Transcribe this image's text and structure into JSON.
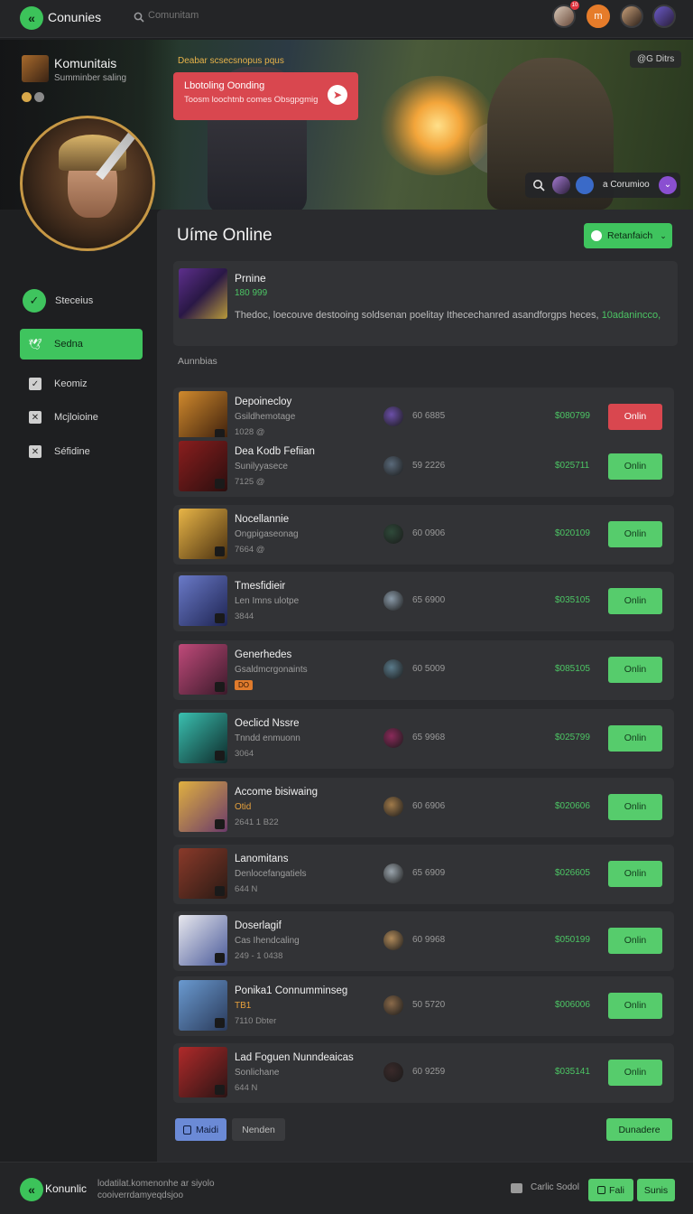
{
  "topbar": {
    "brand": "Conunies",
    "search_placeholder": "Comunitam",
    "notif_count": "10"
  },
  "profile": {
    "name": "Komunitais",
    "status": "Summinber saling"
  },
  "hero": {
    "caption": "Deabar scsecsnopus pqus",
    "tag": "@G Ditrs",
    "promo": {
      "title": "Lbotoling Oonding",
      "subtitle": "Toosm loochtnb comes Obsgpgmig"
    },
    "pill_label": "a Corumioo"
  },
  "nav": [
    {
      "label": "Steceius",
      "icon": "check-icon",
      "active": false
    },
    {
      "label": "Sedna",
      "icon": "bird-icon",
      "active": true
    },
    {
      "label": "Keomiz",
      "icon": "checkbox-icon",
      "active": false
    },
    {
      "label": "Mcjloioine",
      "icon": "x-box-icon",
      "active": false
    },
    {
      "label": "Séfidine",
      "icon": "x-box-icon",
      "active": false
    }
  ],
  "panel": {
    "title": "Uíme Online",
    "filter_button": "Retanfaich",
    "featured": {
      "name": "Prnine",
      "number": "180 999",
      "description": "Thedoc, loecouve destooing soldsenan poelitay Ithecechanred asandforgps heces,",
      "highlight": "10adanincco,"
    },
    "section_label": "Aunnbias",
    "rows": [
      {
        "name": "Depoinecloy",
        "sub": "Gsildhemotage",
        "meta": "1028 @",
        "count": "60 6885",
        "price": "$080799",
        "button": "Onlin",
        "button_style": "red",
        "meta_style": "normal",
        "thumb": [
          "#d08a2d",
          "#3a1d0c"
        ],
        "av": "#6b4fa8"
      },
      {
        "name": "Dea Kodb Fefiian",
        "sub": "Sunilyyasece",
        "meta": "7125 @",
        "count": "59 2226",
        "price": "$025711",
        "button": "Onlin",
        "button_style": "green",
        "meta_style": "normal",
        "thumb": [
          "#8a1e1e",
          "#2a0e0e"
        ],
        "av": "#5a6a7a"
      },
      {
        "name": "Nocellannie",
        "sub": "Ongpigaseonag",
        "meta": "7664 @",
        "count": "60 0906",
        "price": "$020109",
        "button": "Onlin",
        "button_style": "green",
        "meta_style": "normal",
        "thumb": [
          "#e8b547",
          "#4a3010"
        ],
        "av": "#2f4a3a"
      },
      {
        "name": "Tmesfidieir",
        "sub": "Len Imns ulotpe",
        "meta": "3844",
        "count": "65 6900",
        "price": "$035105",
        "button": "Onlin",
        "button_style": "green",
        "meta_style": "normal",
        "thumb": [
          "#6a7ac8",
          "#1e2452"
        ],
        "av": "#8a9aa8"
      },
      {
        "name": "Generhedes",
        "sub": "Gsaldmcrgonaints",
        "meta": "DO",
        "count": "60 5009",
        "price": "$085105",
        "button": "Onlin",
        "button_style": "green",
        "meta_style": "chip",
        "thumb": [
          "#c04a7a",
          "#3a1a2a"
        ],
        "av": "#5a7a8a"
      },
      {
        "name": "Oeclicd Nssre",
        "sub": "Tnndd enmuonn",
        "meta": "3064",
        "count": "65 9968",
        "price": "$025799",
        "button": "Onlin",
        "button_style": "green",
        "meta_style": "normal",
        "thumb": [
          "#3ac0b0",
          "#0e2a2a"
        ],
        "av": "#8a2a5a"
      },
      {
        "name": "Accome bisiwaing",
        "sub": "Otid",
        "meta": "2641 1 B22",
        "count": "60 6906",
        "price": "$020606",
        "button": "Onlin",
        "button_style": "green",
        "meta_style": "normal",
        "thumb": [
          "#e0b040",
          "#6a3a6a"
        ],
        "av": "#a07a4a"
      },
      {
        "name": "Lanomitans",
        "sub": "Denlocefangatiels",
        "meta": "644 N",
        "count": "65 6909",
        "price": "$026605",
        "button": "Onlin",
        "button_style": "green",
        "meta_style": "normal",
        "thumb": [
          "#8a3a2a",
          "#2a1a14"
        ],
        "av": "#9aa4ac"
      },
      {
        "name": "Doserlagif",
        "sub": "Cas Ihendcaling",
        "meta": "249 - 1 0438",
        "count": "60 9968",
        "price": "$050199",
        "button": "Onlin",
        "button_style": "green",
        "meta_style": "normal",
        "thumb": [
          "#e8e8ee",
          "#4a5a9a"
        ],
        "av": "#b08a5a"
      },
      {
        "name": "Ponika1 Connumminseg",
        "sub": "TB1",
        "meta": "7110 Dbter",
        "count": "50 5720",
        "price": "$006006",
        "button": "Onlin",
        "button_style": "green",
        "meta_style": "normal",
        "thumb": [
          "#6a9ad0",
          "#2a3a5a"
        ],
        "av": "#8a6a4a"
      },
      {
        "name": "Lad Foguen Nunndeaicas",
        "sub": "Sonlichane",
        "meta": "644 N",
        "count": "60 9259",
        "price": "$035141",
        "button": "Onlin",
        "button_style": "green",
        "meta_style": "normal",
        "thumb": [
          "#b02a2a",
          "#2a1414"
        ],
        "av": "#3a2a2a"
      }
    ],
    "pagination": {
      "prev": "Maidi",
      "next": "Nenden",
      "right": "Dunadere"
    }
  },
  "footer": {
    "brand": "Konunlic",
    "text": "lodatilat.komenonhe ar siyolo cooiverrdamyeqdsjoo",
    "chat_label": "Carlic Sodol",
    "btn1": "Fali",
    "btn2": "Sunis"
  },
  "colors": {
    "accent": "#3fc45e",
    "danger": "#d9474f",
    "panel": "#2a2b2e",
    "row": "#323336"
  }
}
